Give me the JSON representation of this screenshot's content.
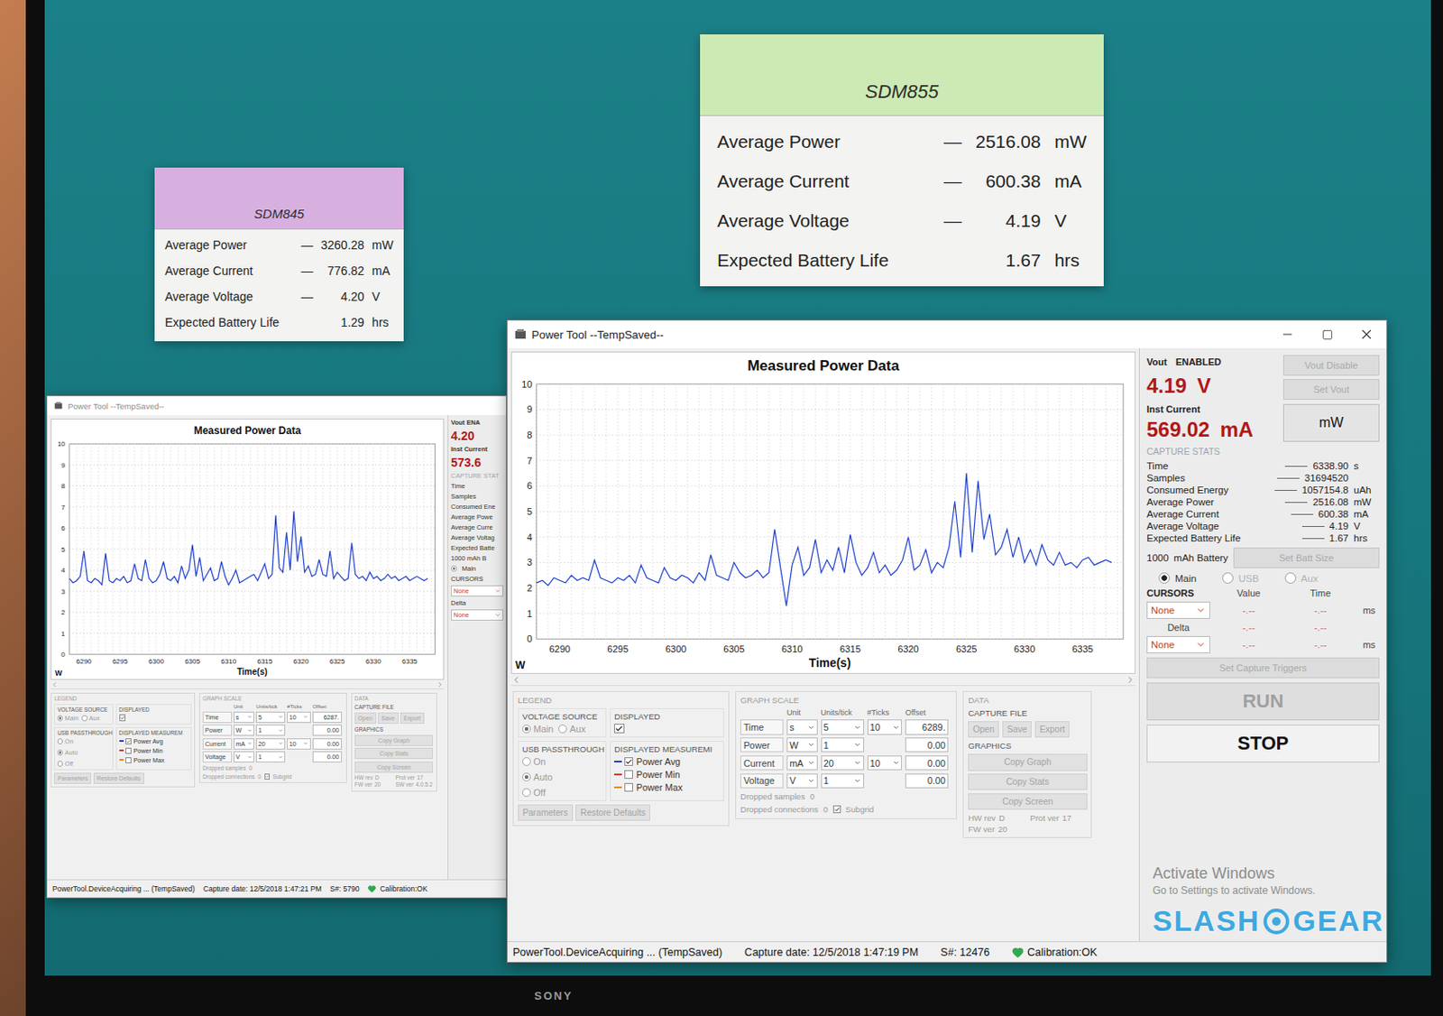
{
  "monitor": {
    "brand": "SONY"
  },
  "watermark": {
    "left": "SLASH",
    "right": "GEAR"
  },
  "activation": {
    "title": "Activate Windows",
    "subtitle": "Go to Settings to activate Windows."
  },
  "cards": [
    {
      "title": "SDM845",
      "color": "#d7b0e0",
      "rows": [
        {
          "label": "Average Power",
          "dash": "—",
          "value": "3260.28",
          "unit": "mW"
        },
        {
          "label": "Average Current",
          "dash": "—",
          "value": "776.82",
          "unit": "mA"
        },
        {
          "label": "Average Voltage",
          "dash": "—",
          "value": "4.20",
          "unit": "V"
        },
        {
          "label": "Expected Battery Life",
          "dash": "",
          "value": "1.29",
          "unit": "hrs"
        }
      ]
    },
    {
      "title": "SDM855",
      "color": "#cdeab4",
      "rows": [
        {
          "label": "Average Power",
          "dash": "—",
          "value": "2516.08",
          "unit": "mW"
        },
        {
          "label": "Average Current",
          "dash": "—",
          "value": "600.38",
          "unit": "mA"
        },
        {
          "label": "Average Voltage",
          "dash": "—",
          "value": "4.19",
          "unit": "V"
        },
        {
          "label": "Expected Battery Life",
          "dash": "",
          "value": "1.67",
          "unit": "hrs"
        }
      ]
    }
  ],
  "windows": [
    {
      "title": "Power Tool --TempSaved--",
      "active": false,
      "chart": {
        "title": "Measured Power Data",
        "x_label": "Time(s)",
        "y_unit": "W",
        "y_ticks": [
          "0",
          "1",
          "2",
          "3",
          "4",
          "5",
          "6",
          "7",
          "8",
          "9",
          "10"
        ],
        "x_ticks": [
          "6290",
          "6295",
          "6300",
          "6305",
          "6310",
          "6315",
          "6320",
          "6325",
          "6330",
          "6335"
        ],
        "series": [
          {
            "name": "Power Avg",
            "color": "#1f3fcf",
            "t_start": 6288,
            "t_step": 0.5,
            "values": [
              3.6,
              3.4,
              3.5,
              3.7,
              4.9,
              3.5,
              3.4,
              3.6,
              3.5,
              3.3,
              4.8,
              3.5,
              3.4,
              3.6,
              3.5,
              3.7,
              3.4,
              3.5,
              4.3,
              3.6,
              3.5,
              4.5,
              3.6,
              3.4,
              3.5,
              3.8,
              4.4,
              3.6,
              3.5,
              3.7,
              3.4,
              4.2,
              3.6,
              4.0,
              5.2,
              3.7,
              4.6,
              3.5,
              3.8,
              4.1,
              3.5,
              3.6,
              4.4,
              3.7,
              3.3,
              3.6,
              4.0,
              3.4,
              3.5,
              3.6,
              3.7,
              3.8,
              3.5,
              3.9,
              4.3,
              3.6,
              3.8,
              6.6,
              4.1,
              3.9,
              5.8,
              4.0,
              6.8,
              4.4,
              5.6,
              3.9,
              4.2,
              3.7,
              3.8,
              4.5,
              3.8,
              3.7,
              4.9,
              3.6,
              3.9,
              3.7,
              3.5,
              3.6,
              5.3,
              3.8,
              3.6,
              3.7,
              3.5,
              3.9,
              3.6,
              3.7,
              3.5,
              3.6,
              3.8,
              3.6,
              3.7,
              3.5,
              3.6,
              3.7,
              3.5,
              3.6,
              3.7,
              3.6,
              3.5,
              3.6
            ]
          }
        ]
      },
      "legend": {
        "title": "LEGEND",
        "voltage_source": {
          "label": "VOLTAGE SOURCE",
          "options": [
            {
              "label": "Main",
              "selected": true
            },
            {
              "label": "Aux",
              "selected": false
            }
          ]
        },
        "displayed": {
          "label": "DISPLAYED",
          "checked": true
        },
        "usb": {
          "label": "USB PASSTHROUGH",
          "options": [
            {
              "label": "On",
              "selected": false
            },
            {
              "label": "Auto",
              "selected": true
            },
            {
              "label": "Off",
              "selected": false
            }
          ]
        },
        "measurements": {
          "label": "DISPLAYED MEASUREM",
          "items": [
            {
              "label": "Power Avg",
              "checked": true,
              "color": "#1f3fcf"
            },
            {
              "label": "Power Min",
              "checked": false,
              "color": "#d03a2a"
            },
            {
              "label": "Power Max",
              "checked": false,
              "color": "#e08a1a"
            }
          ]
        },
        "buttons": [
          {
            "label": "Parameters",
            "disabled": true
          },
          {
            "label": "Restore Defaults",
            "disabled": true
          }
        ]
      },
      "graph_scale": {
        "title": "GRAPH SCALE",
        "columns": [
          "Unit",
          "Units/tick",
          "#Ticks",
          "Offset"
        ],
        "rows": [
          {
            "label": "Time",
            "unit": "s",
            "per_tick": "5",
            "ticks": "10",
            "offset": "6287."
          },
          {
            "label": "Power",
            "unit": "W",
            "per_tick": "1",
            "ticks": "",
            "offset": "0.00"
          },
          {
            "label": "Current",
            "unit": "mA",
            "per_tick": "20",
            "ticks": "10",
            "offset": "0.00"
          },
          {
            "label": "Voltage",
            "unit": "V",
            "per_tick": "1",
            "ticks": "",
            "offset": "0.00"
          }
        ]
      },
      "dropped": [
        {
          "label": "Dropped samples",
          "value": "0"
        },
        {
          "label": "Dropped connections",
          "value": "0"
        }
      ],
      "subgrid": {
        "label": "Subgrid",
        "checked": true
      },
      "data_group": {
        "title": "DATA",
        "capture_file": {
          "label": "CAPTURE FILE",
          "buttons": [
            {
              "label": "Open",
              "disabled": true
            },
            {
              "label": "Save",
              "disabled": true
            },
            {
              "label": "Export",
              "disabled": true
            }
          ]
        },
        "graphics": {
          "label": "GRAPHICS",
          "buttons": [
            {
              "label": "Copy Graph",
              "disabled": true
            },
            {
              "label": "Copy Stats",
              "disabled": true
            },
            {
              "label": "Copy Screen",
              "disabled": true
            }
          ]
        }
      },
      "versions": [
        {
          "label": "HW rev",
          "value": "D"
        },
        {
          "label": "Prot ver",
          "value": "17"
        },
        {
          "label": "FW ver",
          "value": "20"
        },
        {
          "label": "SW ver",
          "value": "4.0.5.2"
        }
      ],
      "side": {
        "kind": "strip",
        "vout_label": "Vout",
        "vout_state": "ENA",
        "vout_value": "4.20",
        "inst_label": "Inst Current",
        "inst_value": "573.6",
        "stats_title": "CAPTURE STAT",
        "stats": [
          "Time",
          "Samples",
          "Consumed Ene",
          "Average Powe",
          "Average Curre",
          "Average Voltag",
          "Expected Batte"
        ],
        "battery": "1000",
        "battery_unit": "mAh B",
        "source": {
          "label": "Main",
          "selected": true
        },
        "cursors": "CURSORS",
        "selects": [
          "None",
          "None"
        ],
        "delta": "Delta"
      },
      "status": {
        "text": "PowerTool.DeviceAcquiring ... (TempSaved)",
        "capture_date": "Capture date: 12/5/2018 1:47:21 PM",
        "serial": "S#: 5790",
        "calibration": "Calibration:OK"
      }
    },
    {
      "title": "Power Tool --TempSaved--",
      "active": true,
      "chart": {
        "title": "Measured Power Data",
        "x_label": "Time(s)",
        "y_unit": "W",
        "y_ticks": [
          "0",
          "1",
          "2",
          "3",
          "4",
          "5",
          "6",
          "7",
          "8",
          "9",
          "10"
        ],
        "x_ticks": [
          "6290",
          "6295",
          "6300",
          "6305",
          "6310",
          "6315",
          "6320",
          "6325",
          "6330",
          "6335"
        ],
        "series": [
          {
            "name": "Power Avg",
            "color": "#1f3fcf",
            "t_start": 6288,
            "t_step": 0.5,
            "values": [
              2.2,
              2.3,
              2.1,
              2.4,
              2.3,
              2.2,
              2.5,
              2.3,
              2.4,
              2.3,
              3.1,
              2.4,
              2.3,
              2.2,
              2.4,
              2.3,
              2.5,
              2.2,
              2.9,
              2.4,
              2.3,
              2.2,
              2.8,
              2.4,
              2.3,
              2.5,
              2.4,
              2.2,
              2.6,
              2.3,
              3.3,
              2.5,
              2.4,
              2.3,
              3.0,
              2.6,
              2.4,
              2.5,
              2.7,
              2.4,
              2.6,
              4.3,
              2.8,
              1.3,
              2.9,
              3.6,
              2.5,
              2.8,
              3.9,
              2.6,
              3.1,
              2.7,
              3.6,
              2.6,
              4.1,
              3.0,
              2.5,
              2.8,
              3.4,
              2.6,
              2.9,
              2.5,
              2.7,
              3.1,
              4.0,
              2.7,
              2.9,
              3.5,
              2.6,
              3.0,
              2.8,
              3.6,
              5.4,
              3.2,
              6.5,
              3.4,
              6.2,
              3.9,
              4.9,
              3.3,
              3.6,
              4.3,
              3.2,
              4.0,
              3.0,
              3.5,
              2.9,
              3.7,
              3.1,
              2.9,
              3.4,
              2.9,
              3.0,
              2.8,
              3.1,
              3.2,
              2.9,
              3.0,
              3.1,
              3.0
            ]
          }
        ]
      },
      "legend": {
        "title": "LEGEND",
        "voltage_source": {
          "label": "VOLTAGE SOURCE",
          "options": [
            {
              "label": "Main",
              "selected": true
            },
            {
              "label": "Aux",
              "selected": false
            }
          ]
        },
        "displayed": {
          "label": "DISPLAYED",
          "checked": true
        },
        "usb": {
          "label": "USB PASSTHROUGH",
          "options": [
            {
              "label": "On",
              "selected": false
            },
            {
              "label": "Auto",
              "selected": true
            },
            {
              "label": "Off",
              "selected": false
            }
          ]
        },
        "measurements": {
          "label": "DISPLAYED MEASUREMI",
          "items": [
            {
              "label": "Power Avg",
              "checked": true,
              "color": "#1f3fcf"
            },
            {
              "label": "Power Min",
              "checked": false,
              "color": "#d03a2a"
            },
            {
              "label": "Power Max",
              "checked": false,
              "color": "#e08a1a"
            }
          ]
        },
        "buttons": [
          {
            "label": "Parameters",
            "disabled": true
          },
          {
            "label": "Restore Defaults",
            "disabled": true
          }
        ]
      },
      "graph_scale": {
        "title": "GRAPH SCALE",
        "columns": [
          "Unit",
          "Units/tick",
          "#Ticks",
          "Offset"
        ],
        "rows": [
          {
            "label": "Time",
            "unit": "s",
            "per_tick": "5",
            "ticks": "10",
            "offset": "6289."
          },
          {
            "label": "Power",
            "unit": "W",
            "per_tick": "1",
            "ticks": "",
            "offset": "0.00"
          },
          {
            "label": "Current",
            "unit": "mA",
            "per_tick": "20",
            "ticks": "10",
            "offset": "0.00"
          },
          {
            "label": "Voltage",
            "unit": "V",
            "per_tick": "1",
            "ticks": "",
            "offset": "0.00"
          }
        ]
      },
      "dropped": [
        {
          "label": "Dropped samples",
          "value": "0"
        },
        {
          "label": "Dropped connections",
          "value": "0"
        }
      ],
      "subgrid": {
        "label": "Subgrid",
        "checked": true
      },
      "data_group": {
        "title": "DATA",
        "capture_file": {
          "label": "CAPTURE FILE",
          "buttons": [
            {
              "label": "Open",
              "disabled": true
            },
            {
              "label": "Save",
              "disabled": true
            },
            {
              "label": "Export",
              "disabled": true
            }
          ]
        },
        "graphics": {
          "label": "GRAPHICS",
          "buttons": [
            {
              "label": "Copy Graph",
              "disabled": true
            },
            {
              "label": "Copy Stats",
              "disabled": true
            },
            {
              "label": "Copy Screen",
              "disabled": true
            }
          ]
        }
      },
      "versions": [
        {
          "label": "HW rev",
          "value": "D"
        },
        {
          "label": "Prot ver",
          "value": "17"
        },
        {
          "label": "FW ver",
          "value": "20"
        }
      ],
      "side": {
        "kind": "panel",
        "vout_label": "Vout",
        "vout_state": "ENABLED",
        "vout_value": "4.19",
        "vout_unit": "V",
        "vout_buttons": [
          {
            "label": "Vout Disable",
            "disabled": true
          },
          {
            "label": "Set Vout",
            "disabled": true
          }
        ],
        "inst_label": "Inst Current",
        "inst_value": "569.02",
        "inst_unit": "mA",
        "unit_button": "mW",
        "stats_title": "CAPTURE STATS",
        "stats": [
          {
            "label": "Time",
            "value": "6338.90",
            "unit": "s"
          },
          {
            "label": "Samples",
            "value": "31694520",
            "unit": ""
          },
          {
            "label": "Consumed Energy",
            "value": "1057154.8",
            "unit": "uAh"
          },
          {
            "label": "Average Power",
            "value": "2516.08",
            "unit": "mW"
          },
          {
            "label": "Average Current",
            "value": "600.38",
            "unit": "mA"
          },
          {
            "label": "Average Voltage",
            "value": "4.19",
            "unit": "V"
          },
          {
            "label": "Expected Battery Life",
            "value": "1.67",
            "unit": "hrs"
          }
        ],
        "battery": {
          "value": "1000",
          "unit": "mAh Battery",
          "button": {
            "label": "Set Batt Size",
            "disabled": true
          }
        },
        "sources": [
          {
            "label": "Main",
            "selected": true
          },
          {
            "label": "USB",
            "selected": false
          },
          {
            "label": "Aux",
            "selected": false
          }
        ],
        "cursors": {
          "title": "CURSORS",
          "columns": [
            "Value",
            "Time"
          ],
          "rows": [
            {
              "select": "None",
              "value": "-.--",
              "time": "-.--",
              "unit": "ms"
            },
            {
              "select": "None",
              "value": "-.--",
              "time": "-.--",
              "unit": "ms"
            }
          ],
          "delta": {
            "label": "Delta",
            "value": "-.--",
            "time": "-.--"
          }
        },
        "triggers": {
          "label": "Set Capture Triggers",
          "disabled": true
        },
        "run": {
          "label": "RUN",
          "disabled": true
        },
        "stop": {
          "label": "STOP",
          "disabled": false
        }
      },
      "status": {
        "text": "PowerTool.DeviceAcquiring ... (TempSaved)",
        "capture_date": "Capture date: 12/5/2018 1:47:19 PM",
        "serial": "S#: 12476",
        "calibration": "Calibration:OK"
      }
    }
  ]
}
